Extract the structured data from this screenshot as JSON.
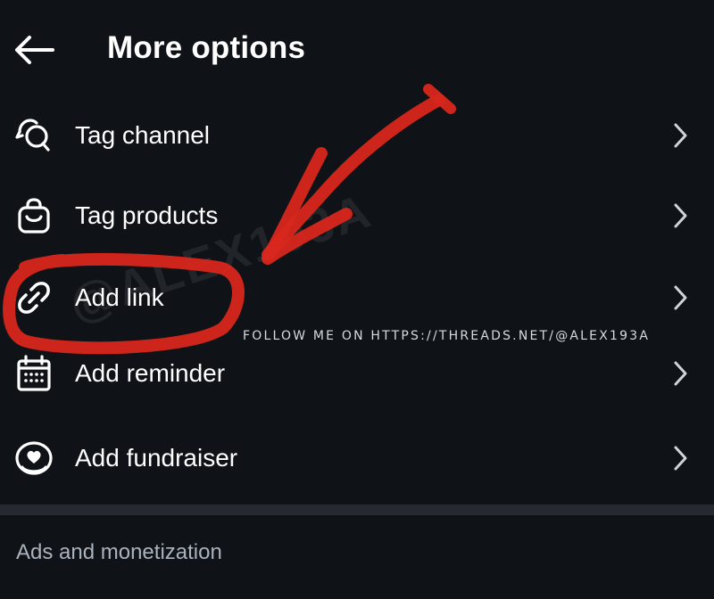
{
  "header": {
    "back_icon": "arrow-left-icon",
    "title": "More options"
  },
  "menu": {
    "items": [
      {
        "label": "Tag channel",
        "icon": "tag-channel-icon",
        "chevron": "chevron-right-icon"
      },
      {
        "label": "Tag products",
        "icon": "shopping-bag-icon",
        "chevron": "chevron-right-icon"
      },
      {
        "label": "Add link",
        "icon": "link-icon",
        "chevron": "chevron-right-icon"
      },
      {
        "label": "Add reminder",
        "icon": "calendar-icon",
        "chevron": "chevron-right-icon"
      },
      {
        "label": "Add fundraiser",
        "icon": "fundraiser-heart-icon",
        "chevron": "chevron-right-icon"
      }
    ]
  },
  "sections": {
    "ads_header": "Ads and monetization"
  },
  "watermark": {
    "handle": "@ALEX193A",
    "text": "FOLLOW ME ON HTTPS://THREADS.NET/@ALEX193A"
  },
  "colors": {
    "background": "#0f1216",
    "text": "#ffffff",
    "secondary_text": "#aab2bd",
    "divider": "#262a30",
    "annotation_red": "#d8271c"
  }
}
